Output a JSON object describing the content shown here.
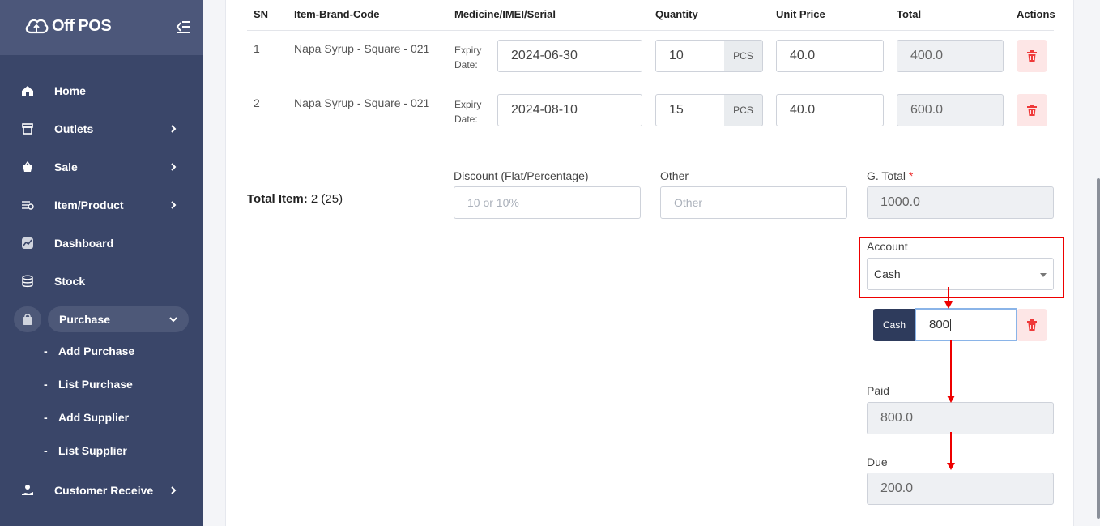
{
  "app": {
    "name": "Off POS"
  },
  "colors": {
    "sidebar": "#3a4669",
    "sidebar_header": "#4c577a",
    "accent_dark": "#2e3b5c",
    "danger": "#ef3a3a",
    "highlight": "#e00000"
  },
  "sidebar": {
    "items": [
      {
        "label": "Home",
        "icon": "home-icon"
      },
      {
        "label": "Outlets",
        "icon": "store-icon"
      },
      {
        "label": "Sale",
        "icon": "basket-icon"
      },
      {
        "label": "Item/Product",
        "icon": "list-icon"
      },
      {
        "label": "Dashboard",
        "icon": "chart-icon"
      },
      {
        "label": "Stock",
        "icon": "database-icon"
      },
      {
        "label": "Purchase",
        "icon": "bag-icon"
      },
      {
        "label": "Customer Receive",
        "icon": "hand-coin-icon"
      }
    ],
    "purchase_sub": [
      "Add Purchase",
      "List Purchase",
      "Add Supplier",
      "List Supplier"
    ],
    "sub_dash": "-"
  },
  "table": {
    "headers": {
      "sn": "SN",
      "item": "Item-Brand-Code",
      "medicine": "Medicine/IMEI/Serial",
      "quantity": "Quantity",
      "unit_price": "Unit Price",
      "total": "Total",
      "actions": "Actions"
    },
    "expiry_label_1": "Expiry",
    "expiry_label_2": "Date:",
    "rows": [
      {
        "sn": "1",
        "item": "Napa Syrup - Square - 021",
        "expiry": "2024-06-30",
        "qty": "10",
        "unit": "PCS",
        "price": "40.0",
        "total": "400.0"
      },
      {
        "sn": "2",
        "item": "Napa Syrup - Square - 021",
        "expiry": "2024-08-10",
        "qty": "15",
        "unit": "PCS",
        "price": "40.0",
        "total": "600.0"
      }
    ]
  },
  "summary": {
    "total_item_label": "Total Item:",
    "total_item_value": "2 (25)",
    "discount_label": "Discount (Flat/Percentage)",
    "discount_placeholder": "10 or 10%",
    "other_label": "Other",
    "other_placeholder": "Other",
    "gtotal_label": "G. Total",
    "gtotal_required": "*",
    "gtotal_value": "1000.0",
    "account_label": "Account",
    "account_value": "Cash",
    "payment_tag": "Cash",
    "payment_value": "800",
    "paid_label": "Paid",
    "paid_value": "800.0",
    "due_label": "Due",
    "due_value": "200.0"
  }
}
